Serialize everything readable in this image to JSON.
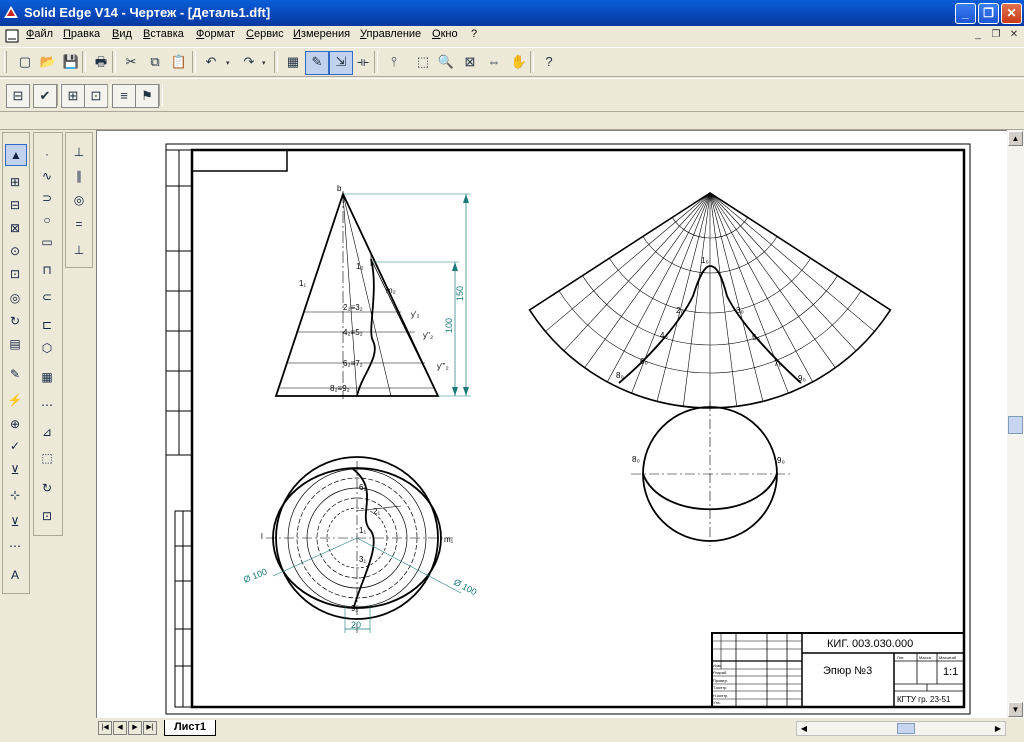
{
  "window": {
    "title": "Solid Edge V14 - Чертеж - [Деталь1.dft]"
  },
  "menu": [
    "Файл",
    "Правка",
    "Вид",
    "Вставка",
    "Формат",
    "Сервис",
    "Измерения",
    "Управление",
    "Окно",
    "?"
  ],
  "toolbar_main": {
    "icons": [
      "new-icon",
      "open-icon",
      "save-icon",
      "print-icon",
      "cut-icon",
      "copy-icon",
      "paste-icon",
      "undo-icon",
      "redo-icon",
      "sheet-setup-icon",
      "edit-icon",
      "arrow-select-icon",
      "dimension-icon",
      "pointer-icon",
      "zoom-area-icon",
      "zoom-icon",
      "fit-icon",
      "pan-icon",
      "pan-hand-icon",
      "help-icon"
    ],
    "glyphs": [
      "▢",
      "📂",
      "💾",
      "🖶",
      "✂",
      "⧉",
      "📋",
      "↶",
      "↷",
      "▦",
      "✎",
      "⇲",
      "⟛",
      "⫯",
      "⬚",
      "🔍",
      "⊠",
      "⇔",
      "✋",
      "?"
    ]
  },
  "toolbar_second": {
    "icons": [
      "filter-icon",
      "check-icon",
      "grid-icon",
      "grid2-icon",
      "layers-icon",
      "flag-icon"
    ],
    "glyphs": [
      "⊟",
      "✔",
      "⊞",
      "⊡",
      "≡",
      "⚑"
    ]
  },
  "left_tools_col1": [
    "▲",
    "⊞",
    "⊟",
    "⊠",
    "⊙",
    "⊡",
    "◎",
    "↻",
    "▤",
    "✎",
    "⚡",
    "⊕",
    "✓",
    "⊻",
    "⊹",
    "⊻",
    "⋯",
    "A"
  ],
  "left_tools_col2": [
    "·",
    "∿",
    "⊃",
    "○",
    "▭",
    "⊓",
    "⊂",
    "⊏",
    "⬡",
    "▦",
    "⋯",
    "⊿",
    "⬚",
    "↻",
    "⊡"
  ],
  "left_tools_col3": [
    "⊥",
    "∥",
    "◎",
    "=",
    "⊥"
  ],
  "drawing": {
    "labels": {
      "s1": "1₁",
      "y1": "1₂",
      "m2": "m₂",
      "b": "b",
      "n23": "2₂≡3₂",
      "n45": "4₂≡5₂",
      "n67": "6₂≡7₂",
      "n89": "8₂≡9₂",
      "y2": "y'₂",
      "y3": "y''₂",
      "y4": "y'''₂",
      "dim150": "150",
      "dim100": "100",
      "d100a": "Ø 100",
      "d100b": "Ø 100",
      "dim20": "20",
      "l1": "l",
      "m1": "m₁",
      "p6": "6₁",
      "p2": "2₁",
      "p1": "1₁",
      "p3": "3₁",
      "p9": "9₁",
      "d1": "1₀",
      "d2": "2₀",
      "d3": "3₀",
      "d4": "4₀",
      "d5": "5₀",
      "d6": "6₀",
      "d7": "7₀",
      "d8": "8₀",
      "d9": "9₀",
      "c8": "8₀",
      "c9": "9₀"
    },
    "stamp": {
      "code": "КИГ. 003.030.000",
      "title": "Эпюр №3",
      "scale": "1:1",
      "org": "КГТУ гр. 23-51",
      "head1": "Лит.",
      "head2": "Масса",
      "head3": "Масштаб",
      "rows": [
        "Изм.",
        "Разраб.",
        "Провер.",
        "Т.контр.",
        "Н.контр.",
        "Утв."
      ]
    }
  },
  "sheet_tab": "Лист1"
}
